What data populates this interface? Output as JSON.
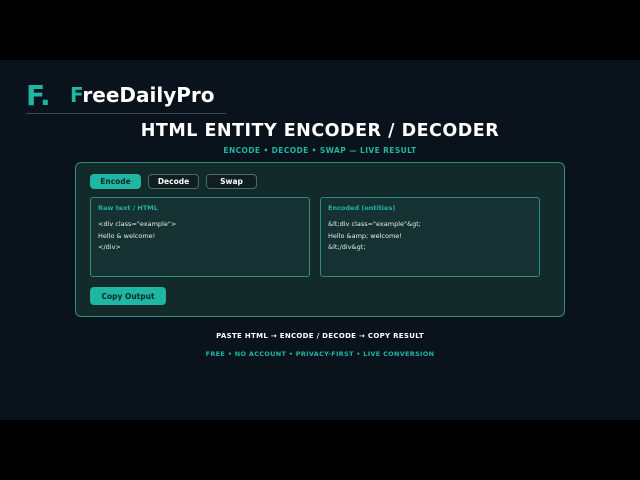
{
  "brand": {
    "mark": "F.",
    "name_first": "F",
    "name_rest": "reeDailyPro"
  },
  "header": {
    "title": "HTML ENTITY ENCODER / DECODER",
    "subtitle": "ENCODE  •  DECODE  •  SWAP  —  LIVE RESULT"
  },
  "tabs": [
    {
      "label": "Encode",
      "active": true
    },
    {
      "label": "Decode",
      "active": false
    },
    {
      "label": "Swap",
      "active": false
    }
  ],
  "input": {
    "label": "Raw text / HTML",
    "lines": [
      "<div class=\"example\">",
      "Hello & welcome!",
      "</div>"
    ]
  },
  "output": {
    "label": "Encoded (entities)",
    "lines": [
      "&lt;div class=\"example\"&gt;",
      "Hello &amp; welcome!",
      "&lt;/div&gt;"
    ]
  },
  "actions": {
    "copy_label": "Copy Output"
  },
  "footer": {
    "flow": "PASTE HTML  →  ENCODE / DECODE  →  COPY RESULT",
    "features": "FREE  •  NO ACCOUNT  •  PRIVACY-FIRST  •  LIVE CONVERSION"
  },
  "colors": {
    "accent": "#1fb6a2",
    "background": "#0a121c",
    "panel": "#122a2a"
  }
}
